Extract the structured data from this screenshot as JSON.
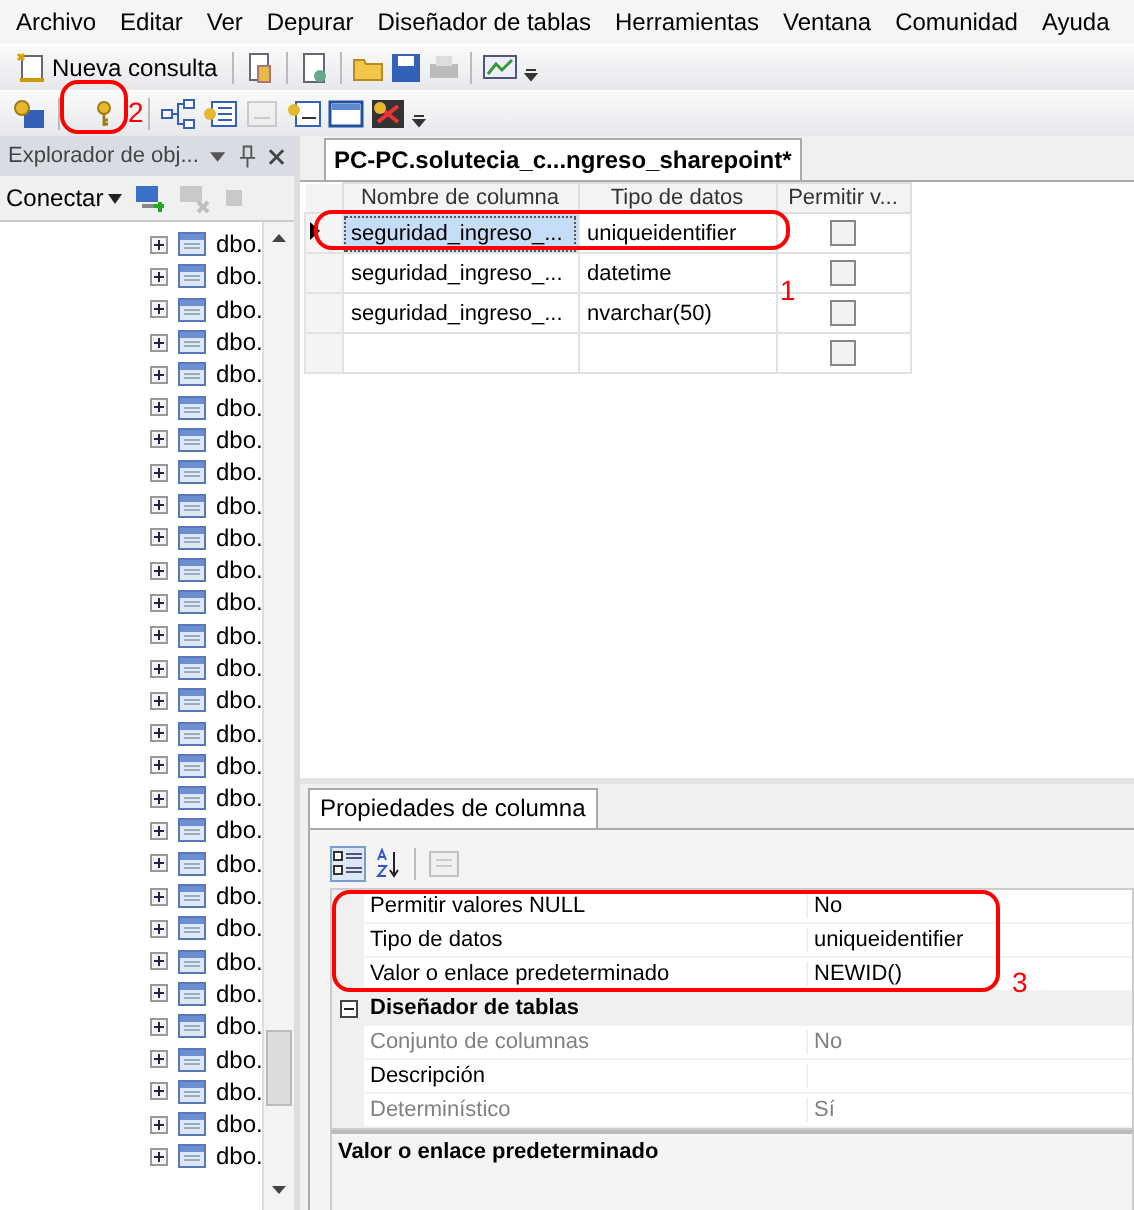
{
  "menu": [
    "Archivo",
    "Editar",
    "Ver",
    "Depurar",
    "Diseñador de tablas",
    "Herramientas",
    "Ventana",
    "Comunidad",
    "Ayuda"
  ],
  "toolbar": {
    "new_query": "Nueva consulta"
  },
  "explorer": {
    "title": "Explorador de obj...",
    "connect": "Conectar",
    "items": [
      {
        "label": "dbo.",
        "expanded": false
      },
      {
        "label": "dbo.",
        "expanded": false
      },
      {
        "label": "dbo.",
        "expanded": false
      },
      {
        "label": "dbo.",
        "expanded": false
      },
      {
        "label": "dbo.",
        "expanded": false
      },
      {
        "label": "dbo.",
        "expanded": false
      },
      {
        "label": "dbo.",
        "expanded": false
      },
      {
        "label": "dbo.",
        "expanded": false
      },
      {
        "label": "dbo.",
        "expanded": false
      },
      {
        "label": "dbo.",
        "expanded": false
      },
      {
        "label": "dbo.",
        "expanded": false
      },
      {
        "label": "dbo.",
        "expanded": false
      },
      {
        "label": "dbo.",
        "expanded": false
      },
      {
        "label": "dbo.",
        "expanded": false
      },
      {
        "label": "dbo.",
        "expanded": false
      },
      {
        "label": "dbo.",
        "expanded": false
      },
      {
        "label": "dbo.",
        "expanded": false
      },
      {
        "label": "dbo.",
        "expanded": false
      },
      {
        "label": "dbo.",
        "expanded": false
      },
      {
        "label": "dbo.",
        "expanded": false
      },
      {
        "label": "dbo.",
        "expanded": false
      },
      {
        "label": "dbo.",
        "expanded": false
      },
      {
        "label": "dbo.",
        "expanded": false
      },
      {
        "label": "dbo.",
        "expanded": false
      },
      {
        "label": "dbo.",
        "expanded": false
      },
      {
        "label": "dbo.",
        "expanded": false
      },
      {
        "label": "dbo.",
        "expanded": false
      },
      {
        "label": "dbo.",
        "expanded": false
      },
      {
        "label": "dbo.",
        "expanded": false
      }
    ]
  },
  "document_tab": {
    "title": "PC-PC.solutecia_c...ngreso_sharepoint*",
    "selected": true
  },
  "table": {
    "columns": [
      "Nombre de columna",
      "Tipo de datos",
      "Permitir v..."
    ],
    "rows": [
      {
        "name": "seguridad_ingreso_...",
        "type": "uniqueidentifier",
        "allow_null": false,
        "selected": true
      },
      {
        "name": "seguridad_ingreso_...",
        "type": "datetime",
        "allow_null": false,
        "selected": false
      },
      {
        "name": "seguridad_ingreso_...",
        "type": "nvarchar(50)",
        "allow_null": false,
        "selected": false
      },
      {
        "name": "",
        "type": "",
        "allow_null": false,
        "selected": false
      }
    ]
  },
  "properties": {
    "tab": "Propiedades de columna",
    "rows": [
      {
        "kind": "property",
        "name": "Permitir valores NULL",
        "value": "No",
        "disabled": false
      },
      {
        "kind": "property",
        "name": "Tipo de datos",
        "value": "uniqueidentifier",
        "disabled": false
      },
      {
        "kind": "property",
        "name": "Valor o enlace predeterminado",
        "value": "NEWID()",
        "disabled": false
      },
      {
        "kind": "category",
        "name": "Diseñador de tablas",
        "expanded": true
      },
      {
        "kind": "property",
        "name": "Conjunto de columnas",
        "value": "No",
        "disabled": true
      },
      {
        "kind": "property",
        "name": "Descripción",
        "value": "",
        "disabled": false
      },
      {
        "kind": "property",
        "name": "Determinístico",
        "value": "Sí",
        "disabled": true
      }
    ],
    "description": "Valor o enlace predeterminado"
  },
  "annotations": [
    "1",
    "2",
    "3"
  ]
}
